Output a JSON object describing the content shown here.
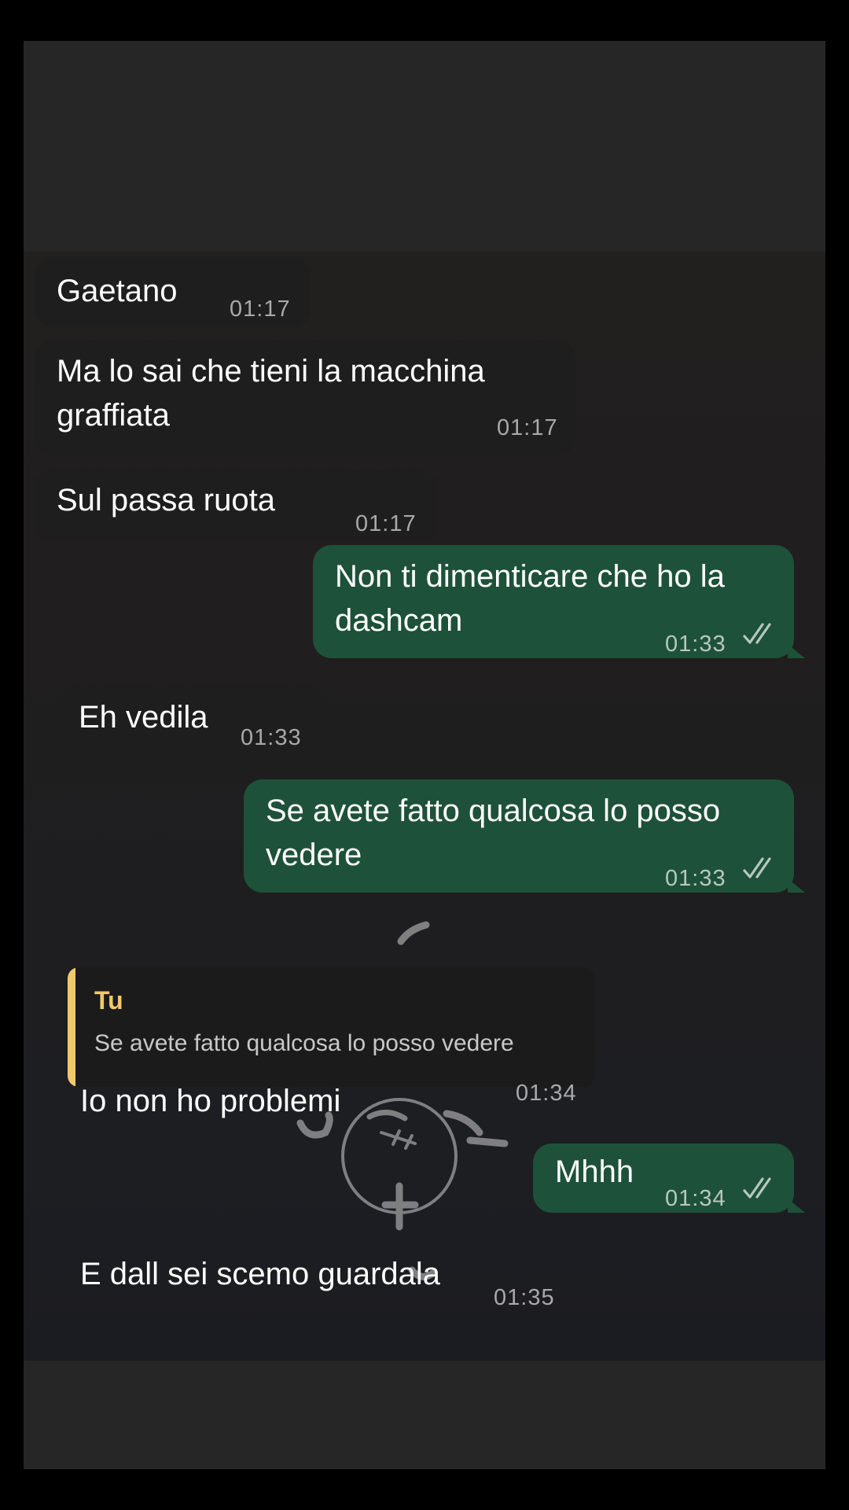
{
  "messages": [
    {
      "direction": "incoming",
      "text": "Gaetano",
      "time": "01:17"
    },
    {
      "direction": "incoming",
      "text": "Ma lo sai che tieni la macchina\ngraffiata",
      "time": "01:17"
    },
    {
      "direction": "incoming",
      "text": "Sul passa ruota",
      "time": "01:17"
    },
    {
      "direction": "outgoing",
      "text": "Non ti dimenticare che ho la\ndashcam",
      "time": "01:33",
      "status_icon": "double-check-icon"
    },
    {
      "direction": "incoming",
      "text": "Eh vedila",
      "time": "01:33"
    },
    {
      "direction": "outgoing",
      "text": "Se avete fatto qualcosa lo posso\nvedere",
      "time": "01:33",
      "status_icon": "double-check-icon"
    },
    {
      "direction": "incoming",
      "quote": {
        "author": "Tu",
        "text": "Se avete fatto qualcosa lo posso vedere"
      },
      "text": "Io non ho problemi",
      "time": "01:34"
    },
    {
      "direction": "outgoing",
      "text": "Mhhh",
      "time": "01:34",
      "status_icon": "double-check-icon"
    },
    {
      "direction": "incoming",
      "text": "E dall sei scemo guardala",
      "time": "01:35"
    }
  ],
  "colors": {
    "background": "#000000",
    "chat_area": "#262626",
    "incoming_bubble": "#1e1e1e",
    "outgoing_bubble": "#1e5139",
    "quote_accent": "#f2c96a",
    "timestamp": "#a9a9a9"
  }
}
